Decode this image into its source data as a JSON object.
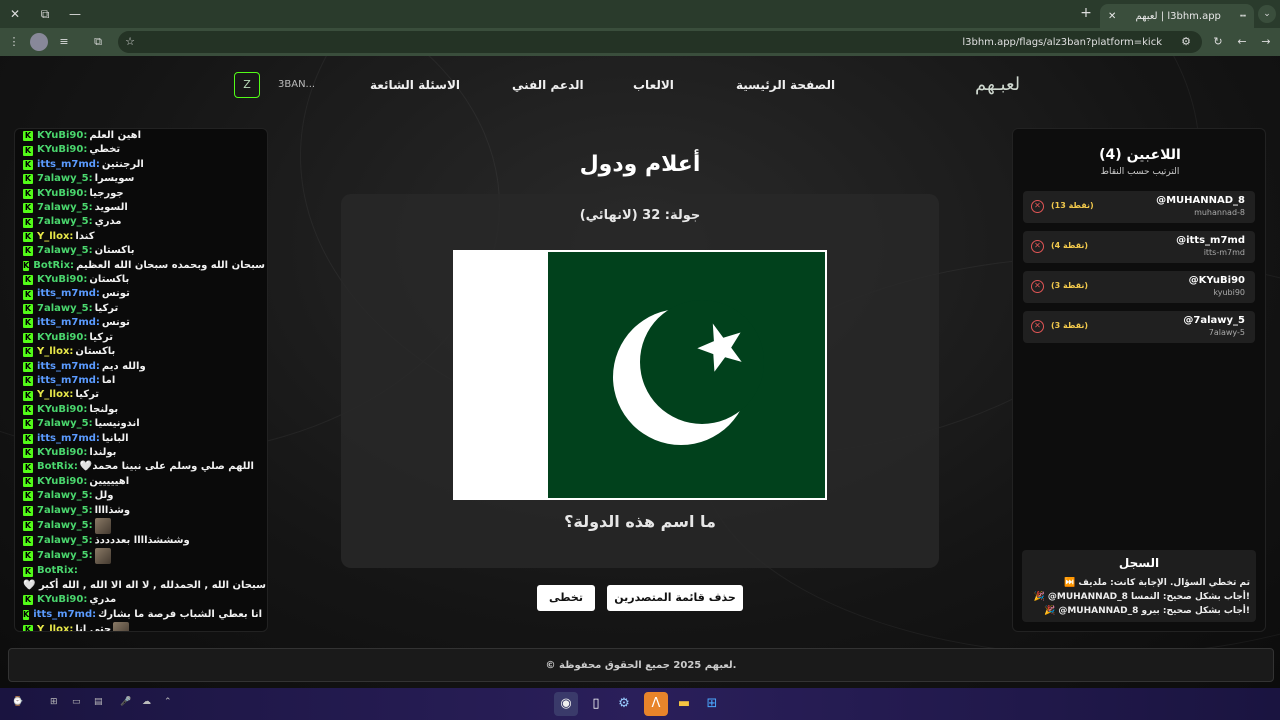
{
  "browser": {
    "tab_title": "لعبهم | l3bhm.app",
    "url": "l3bhm.app/flags/alz3ban?platform=kick",
    "win_minimize": "—",
    "win_restore": "⧉",
    "win_close": "✕",
    "new_tab": "+",
    "tab_close": "✕"
  },
  "nav": {
    "logo": "لعبـهم",
    "items": [
      "الصفحة الرئيسية",
      "الالعاب",
      "الدعم الفني",
      "الاسئلة الشائعة"
    ],
    "user": "3BAN...",
    "kick_btn": "Z"
  },
  "chat": {
    "messages": [
      {
        "user": "KYuBi90:",
        "color": "#4ad66d",
        "text": "اهين العلم"
      },
      {
        "user": "KYuBi90:",
        "color": "#4ad66d",
        "text": "تخطي"
      },
      {
        "user": "itts_m7md:",
        "color": "#5b9bff",
        "text": "الرجنتين"
      },
      {
        "user": "7alawy_5:",
        "color": "#4ad66d",
        "text": "سويسرا"
      },
      {
        "user": "KYuBi90:",
        "color": "#4ad66d",
        "text": "جورجيا"
      },
      {
        "user": "7alawy_5:",
        "color": "#4ad66d",
        "text": "السويد"
      },
      {
        "user": "7alawy_5:",
        "color": "#4ad66d",
        "text": "مدري"
      },
      {
        "user": "Y_llox:",
        "color": "#e8e84a",
        "text": "كندا"
      },
      {
        "user": "7alawy_5:",
        "color": "#4ad66d",
        "text": "باكستان"
      },
      {
        "user": "BotRix:",
        "color": "#4ad66d",
        "text": "سبحان الله وبحمده سبحان الله العظيم 🤍"
      },
      {
        "user": "KYuBi90:",
        "color": "#4ad66d",
        "text": "باكستان"
      },
      {
        "user": "itts_m7md:",
        "color": "#5b9bff",
        "text": "تونس"
      },
      {
        "user": "7alawy_5:",
        "color": "#4ad66d",
        "text": "تركيا"
      },
      {
        "user": "itts_m7md:",
        "color": "#5b9bff",
        "text": "تونس"
      },
      {
        "user": "KYuBi90:",
        "color": "#4ad66d",
        "text": "تركيا"
      },
      {
        "user": "Y_llox:",
        "color": "#e8e84a",
        "text": "باكستان"
      },
      {
        "user": "itts_m7md:",
        "color": "#5b9bff",
        "text": "والله ديم"
      },
      {
        "user": "itts_m7md:",
        "color": "#5b9bff",
        "text": "اما"
      },
      {
        "user": "Y_llox:",
        "color": "#e8e84a",
        "text": "تركيا"
      },
      {
        "user": "KYuBi90:",
        "color": "#4ad66d",
        "text": "بولنجا"
      },
      {
        "user": "7alawy_5:",
        "color": "#4ad66d",
        "text": "اندونيسيا"
      },
      {
        "user": "itts_m7md:",
        "color": "#5b9bff",
        "text": "البانيا"
      },
      {
        "user": "KYuBi90:",
        "color": "#4ad66d",
        "text": "بولندا"
      },
      {
        "user": "BotRix:",
        "color": "#4ad66d",
        "text": "🤍اللهم صلي وسلم على نبينا محمد"
      },
      {
        "user": "KYuBi90:",
        "color": "#4ad66d",
        "text": "اهييييين"
      },
      {
        "user": "7alawy_5:",
        "color": "#4ad66d",
        "text": "ولل"
      },
      {
        "user": "7alawy_5:",
        "color": "#4ad66d",
        "text": "وشذاااا"
      },
      {
        "user": "7alawy_5:",
        "color": "#4ad66d",
        "text": "",
        "avatar": true
      },
      {
        "user": "7alawy_5:",
        "color": "#4ad66d",
        "text": "وشششذاااا بعددددذ"
      },
      {
        "user": "7alawy_5:",
        "color": "#4ad66d",
        "text": "",
        "avatar": true
      },
      {
        "user": "BotRix:",
        "color": "#4ad66d",
        "text": ""
      },
      {
        "user": "",
        "color": "#4ad66d",
        "text": "🤍 سبحان الله , الحمدلله , لا اله الا الله , الله أكبر",
        "nobadge": true
      },
      {
        "user": "KYuBi90:",
        "color": "#4ad66d",
        "text": "مدري"
      },
      {
        "user": "itts_m7md:",
        "color": "#5b9bff",
        "text": "انا بعطي الشباب فرصة ما بشارك"
      },
      {
        "user": "Y_llox:",
        "color": "#e8e84a",
        "text": "حتى انا",
        "avatar_after": true
      }
    ]
  },
  "game": {
    "title": "أعلام ودول",
    "round": "جولة: 32 (لانهائي)",
    "question": "ما اسم هذه الدولة؟",
    "skip_btn": "تخطى",
    "clear_btn": "حذف قائمة المتصدرين"
  },
  "players": {
    "title": "اللاعبين (4)",
    "subtitle": "الترتيب حسب النقاط",
    "list": [
      {
        "name": "@MUHANNAD_8",
        "handle": "muhannad-8",
        "points": "(13 نقطة)"
      },
      {
        "name": "@itts_m7md",
        "handle": "itts-m7md",
        "points": "(4 نقطة)"
      },
      {
        "name": "@KYuBi90",
        "handle": "kyubi90",
        "points": "(3 نقطة)"
      },
      {
        "name": "@7alawy_5",
        "handle": "7alawy-5",
        "points": "(3 نقطة)"
      }
    ]
  },
  "log": {
    "title": "السجل",
    "lines": [
      "⏭️ تم تخطي السؤال. الإجابة كانت: ملديف",
      "🎉 @MUHANNAD_8 أجاب بشكل صحيح: النمسا!",
      "🎉 @MUHANNAD_8 أجاب بشكل صحيح: بيرو!"
    ]
  },
  "footer": {
    "text": "© لعبهم 2025 جميع الحقوق محفوظة."
  },
  "colors": {
    "kick_green": "#53fc18",
    "flag_green": "#01411c"
  }
}
